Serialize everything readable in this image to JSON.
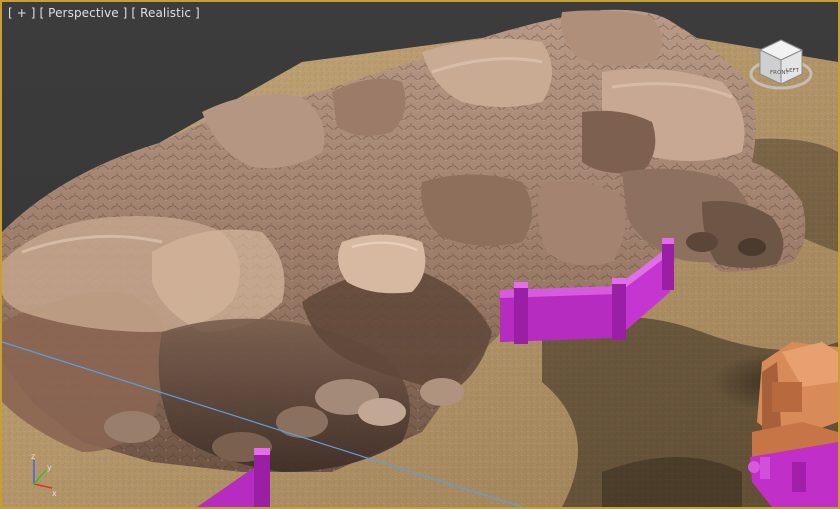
{
  "viewport": {
    "label_plus": "[ + ]",
    "label_view": "[ Perspective ]",
    "label_shading": "[ Realistic ]"
  },
  "viewcube": {
    "icon": "viewcube-icon",
    "face_front": "FRONT",
    "face_left": "LEFT"
  },
  "axis_tripod": {
    "icon": "axis-tripod-icon",
    "x": "x",
    "y": "y",
    "z": "z"
  },
  "colors": {
    "frame_active": "#c8a032",
    "background": "#3a3a3a",
    "ground": "#b79a6b",
    "rock": "#8a6a55",
    "fence": "#c030c8",
    "horizon_line": "#5aa0e0"
  }
}
